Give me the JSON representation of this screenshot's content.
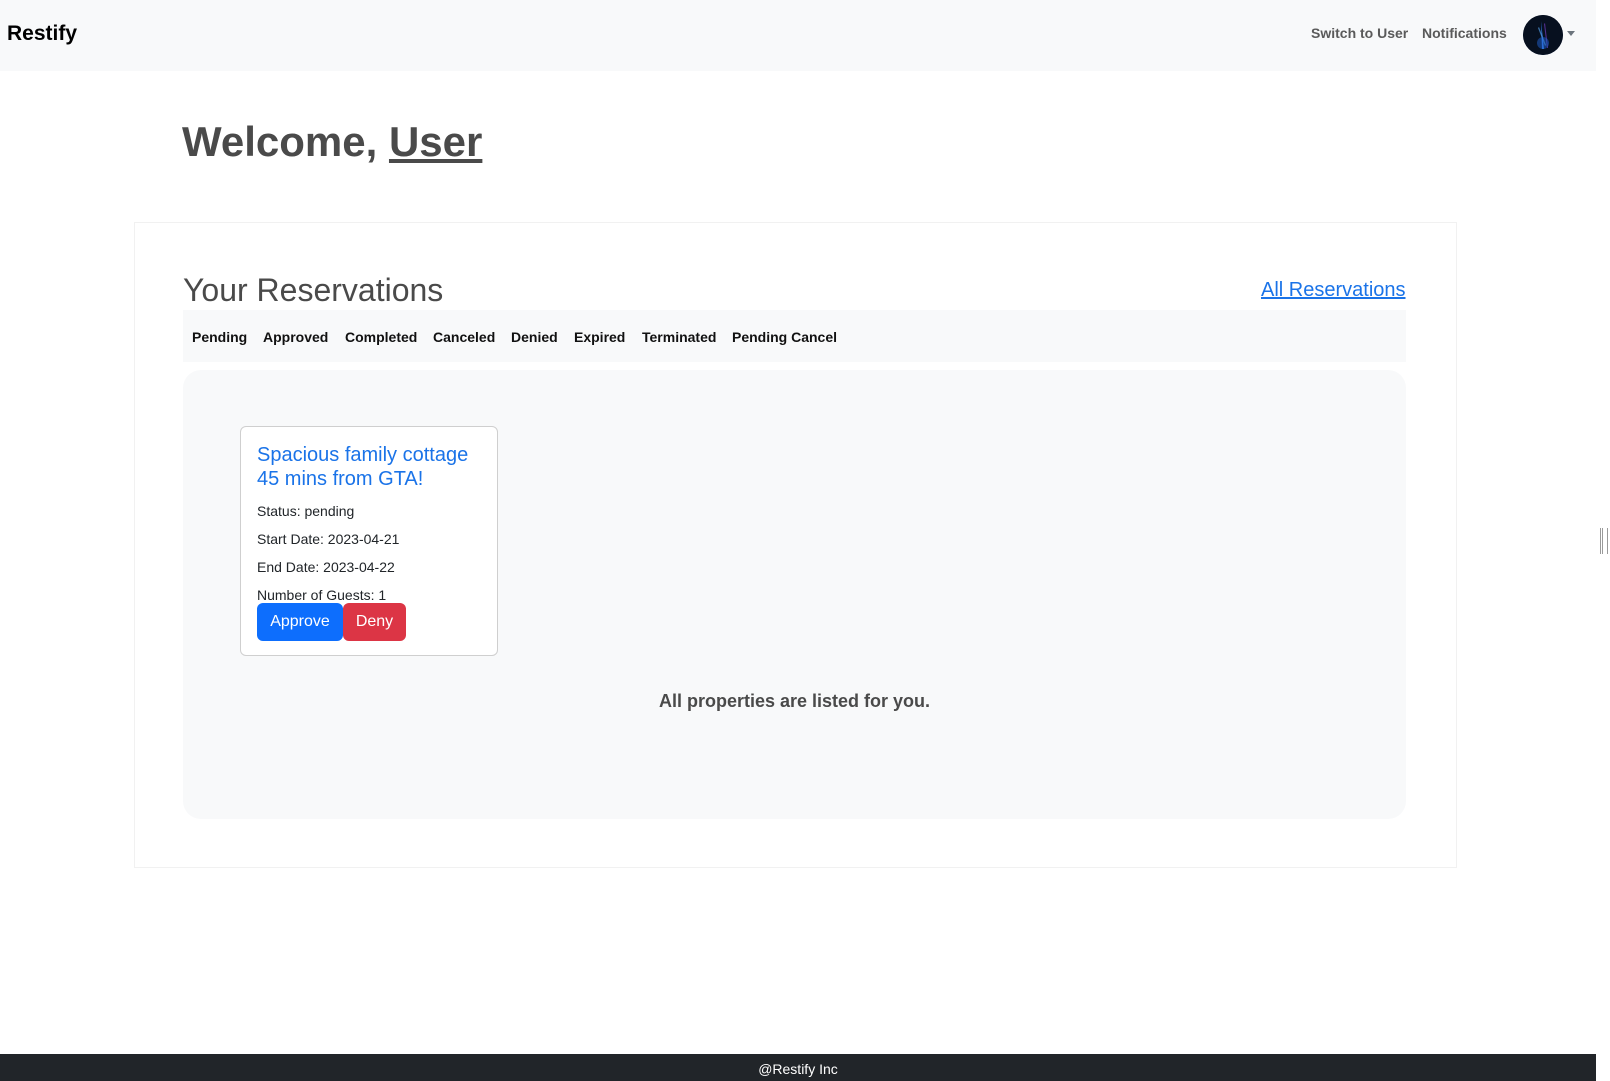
{
  "navbar": {
    "brand": "Restify",
    "switch_label": "Switch to User",
    "notifications_label": "Notifications",
    "avatar_icon": "user-avatar",
    "dropdown_icon": "caret-down-icon"
  },
  "welcome": {
    "prefix": "Welcome, ",
    "user": "User"
  },
  "reservations": {
    "title": "Your Reservations",
    "all_link": "All Reservations",
    "tabs": [
      "Pending",
      "Approved",
      "Completed",
      "Canceled",
      "Denied",
      "Expired",
      "Terminated",
      "Pending Cancel"
    ],
    "cards": [
      {
        "title": "Spacious family cottage 45 mins from GTA!",
        "status": "Status: pending",
        "start": "Start Date: 2023-04-21",
        "end": "End Date: 2023-04-22",
        "guests": "Number of Guests: 1",
        "approve_label": "Approve",
        "deny_label": "Deny"
      }
    ],
    "footer_message": "All properties are listed for you."
  },
  "footer": {
    "text": "@Restify Inc"
  },
  "colors": {
    "link": "#1a73e8",
    "approve": "#0d6efd",
    "deny": "#dc3545",
    "footer_bg": "#212529",
    "navbar_bg": "#f8f9fa"
  }
}
